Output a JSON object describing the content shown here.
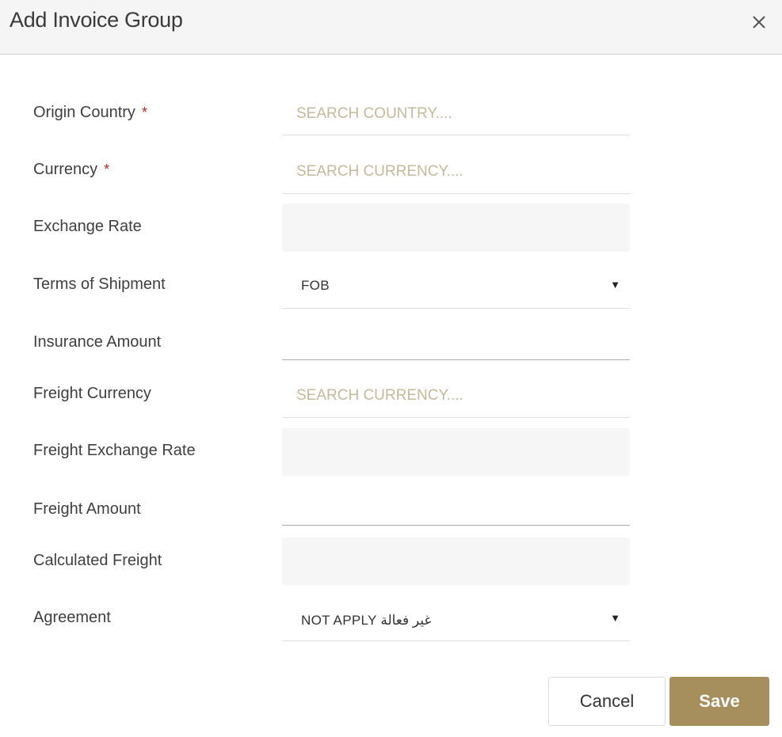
{
  "modal": {
    "title": "Add Invoice Group",
    "close_icon": "close-icon"
  },
  "form": {
    "origin_country": {
      "label": "Origin Country",
      "required_mark": "*",
      "placeholder": "SEARCH COUNTRY...."
    },
    "currency": {
      "label": "Currency",
      "required_mark": "*",
      "placeholder": "SEARCH CURRENCY...."
    },
    "exchange_rate": {
      "label": "Exchange Rate",
      "value": ""
    },
    "terms_of_shipment": {
      "label": "Terms of Shipment",
      "selected": "FOB",
      "caret": "▼"
    },
    "insurance_amount": {
      "label": "Insurance Amount",
      "value": ""
    },
    "freight_currency": {
      "label": "Freight Currency",
      "placeholder": "SEARCH CURRENCY...."
    },
    "freight_exchange_rate": {
      "label": "Freight Exchange Rate",
      "value": ""
    },
    "freight_amount": {
      "label": "Freight Amount",
      "value": ""
    },
    "calculated_freight": {
      "label": "Calculated Freight",
      "value": ""
    },
    "agreement": {
      "label": "Agreement",
      "selected": "NOT APPLY غير فعالة",
      "caret": "▼"
    }
  },
  "footer": {
    "cancel_label": "Cancel",
    "save_label": "Save"
  },
  "colors": {
    "accent": "#a78f5d",
    "required": "#b5281f",
    "placeholder": "#c4b99a",
    "header_bg": "#f5f5f5"
  }
}
